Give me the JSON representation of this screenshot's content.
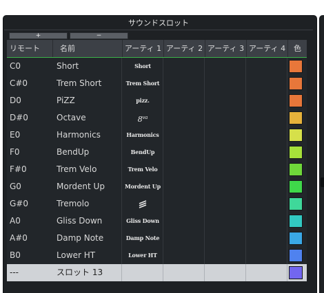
{
  "panel": {
    "title": "サウンドスロット",
    "add_label": "+",
    "remove_label": "−"
  },
  "columns": [
    "リモート",
    "名前",
    "アーティ 1",
    "アーティ 2",
    "アーティ 3",
    "アーティ 4",
    "色"
  ],
  "rows": [
    {
      "remote": "C0",
      "name": "Short",
      "art1": "Short",
      "color": "#e8773a"
    },
    {
      "remote": "C#0",
      "name": "Trem Short",
      "art1": "Trem Short",
      "color": "#e8773a"
    },
    {
      "remote": "D0",
      "name": "PiZZ",
      "art1": "pizz.",
      "color": "#e8773a"
    },
    {
      "remote": "D#0",
      "name": "Octave",
      "art1": "8va",
      "color": "#e6b23b"
    },
    {
      "remote": "E0",
      "name": "Harmonics",
      "art1": "Harmonics",
      "color": "#d6e04a"
    },
    {
      "remote": "F0",
      "name": "BendUp",
      "art1": "BendUp",
      "color": "#a6e03a"
    },
    {
      "remote": "F#0",
      "name": "Trem Velo",
      "art1": "Trem Velo",
      "color": "#6fd83a"
    },
    {
      "remote": "G0",
      "name": "Mordent Up",
      "art1": "Mordent Up",
      "color": "#3fd84a"
    },
    {
      "remote": "G#0",
      "name": "Tremolo",
      "art1": "tremolo-glyph",
      "color": "#3fd89a"
    },
    {
      "remote": "A0",
      "name": "Gliss Down",
      "art1": "Gliss Down",
      "color": "#32c9c2"
    },
    {
      "remote": "A#0",
      "name": "Damp Note",
      "art1": "Damp Note",
      "color": "#3aa8e6"
    },
    {
      "remote": "B0",
      "name": "Lower HT",
      "art1": "Lower HT",
      "color": "#4f82ef"
    },
    {
      "remote": "---",
      "name": "スロット 13",
      "art1": "",
      "color": "#7266f0",
      "selected": true
    }
  ]
}
